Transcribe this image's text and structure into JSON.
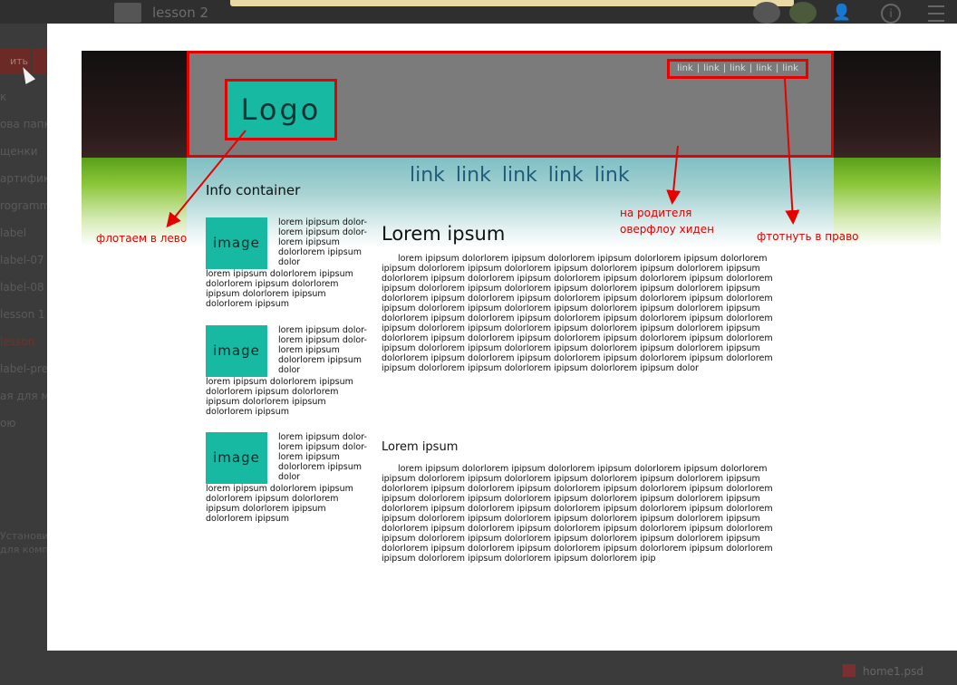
{
  "background_app": {
    "folder_title": "lesson 2",
    "sidebar_button": "ить",
    "sidebar_items": [
      "к",
      "ова папка",
      "щенки",
      "артифик",
      "rogramm",
      "label",
      "label-07",
      "label-08",
      "lesson 1",
      "lesson",
      "label-pre",
      "ая для ме",
      "ою"
    ],
    "sidebar_bottom": [
      "Установи",
      "для комп"
    ],
    "file_name": "home1.psd"
  },
  "mockup": {
    "logo": "Logo",
    "top_links": [
      "link",
      "link",
      "link",
      "link",
      "link"
    ],
    "main_links": [
      "link",
      "link",
      "link",
      "link",
      "link"
    ],
    "info_title": "Info container",
    "cards": [
      {
        "image_label": "image",
        "side_text": "lorem ipipsum dolor-lorem ipipsum dolor-lorem ipipsum dolorlorem ipipsum dolor",
        "rest_text": "lorem ipipsum dolorlorem ipipsum dolorlorem ipipsum dolorlorem ipipsum dolorlorem ipipsum dolorlorem ipipsum"
      },
      {
        "image_label": "image",
        "side_text": "lorem ipipsum dolor-lorem ipipsum dolor-lorem ipipsum dolorlorem ipipsum dolor",
        "rest_text": "lorem ipipsum dolorlorem ipipsum dolorlorem ipipsum dolorlorem ipipsum dolorlorem ipipsum dolorlorem ipipsum"
      },
      {
        "image_label": "image",
        "side_text": "lorem ipipsum dolor-lorem ipipsum dolor-lorem ipipsum dolorlorem ipipsum dolor",
        "rest_text": "lorem ipipsum dolorlorem ipipsum dolorlorem ipipsum dolorlorem ipipsum dolorlorem ipipsum dolorlorem ipipsum"
      }
    ],
    "article1": {
      "title": "Lorem ipsum",
      "body": "lorem ipipsum dolorlorem ipipsum dolorlorem ipipsum dolorlorem ipipsum dolorlorem ipipsum dolorlorem ipipsum dolorlorem ipipsum dolorlorem ipipsum dolorlorem ipipsum dolorlorem ipipsum dolorlorem ipipsum dolorlorem ipipsum dolorlorem ipipsum dolorlorem ipipsum dolorlorem ipipsum dolorlorem ipipsum dolorlorem ipipsum dolorlorem ipipsum dolorlorem ipipsum dolorlorem ipipsum dolorlorem ipipsum dolorlorem ipipsum dolorlorem ipipsum dolorlorem ipipsum dolorlorem ipipsum dolorlorem ipipsum dolorlorem ipipsum dolorlorem ipipsum dolorlorem ipipsum dolorlorem ipipsum dolorlorem ipipsum dolorlorem ipipsum dolorlorem ipipsum dolorlorem ipipsum dolorlorem ipipsum dolorlorem ipipsum dolorlorem ipipsum dolorlorem ipipsum dolorlorem ipipsum dolorlorem ipipsum dolorlorem ipipsum dolorlorem ipipsum dolorlorem ipipsum dolorlorem ipipsum dolorlorem ipipsum dolorlorem ipipsum dolorlorem ipipsum dolorlorem ipipsum dolorlorem ipipsum dolorlorem ipipsum dolorlorem ipipsum dolorlorem ipipsum dolorlorem ipipsum dolor"
    },
    "article2": {
      "title": "Lorem ipsum",
      "body": "lorem ipipsum dolorlorem ipipsum dolorlorem ipipsum dolorlorem ipipsum dolorlorem ipipsum dolorlorem ipipsum dolorlorem ipipsum dolorlorem ipipsum dolorlorem ipipsum dolorlorem ipipsum dolorlorem ipipsum dolorlorem ipipsum dolorlorem ipipsum dolorlorem ipipsum dolorlorem ipipsum dolorlorem ipipsum dolorlorem ipipsum dolorlorem ipipsum dolorlorem ipipsum dolorlorem ipipsum dolorlorem ipipsum dolorlorem ipipsum dolorlorem ipipsum dolorlorem ipipsum dolorlorem ipipsum dolorlorem ipipsum dolorlorem ipipsum dolorlorem ipipsum dolorlorem ipipsum dolorlorem ipipsum dolorlorem ipipsum dolorlorem ipipsum dolorlorem ipipsum dolorlorem ipipsum dolorlorem ipipsum dolorlorem ipipsum dolorlorem ipipsum dolorlorem ipipsum dolorlorem ipipsum dolorlorem ipipsum dolorlorem ipipsum dolorlorem ipipsum dolorlorem ipipsum dolorlorem ipip"
    }
  },
  "annotations": {
    "float_left": "флотаем в лево",
    "overflow_hidden_line1": "на родителя",
    "overflow_hidden_line2": "оверфлоу хиден",
    "float_right": "фтотнуть в право"
  },
  "colors": {
    "annotation_red": "#e60000",
    "teal": "#17b9a3",
    "link_blue": "#1f5c7c"
  }
}
